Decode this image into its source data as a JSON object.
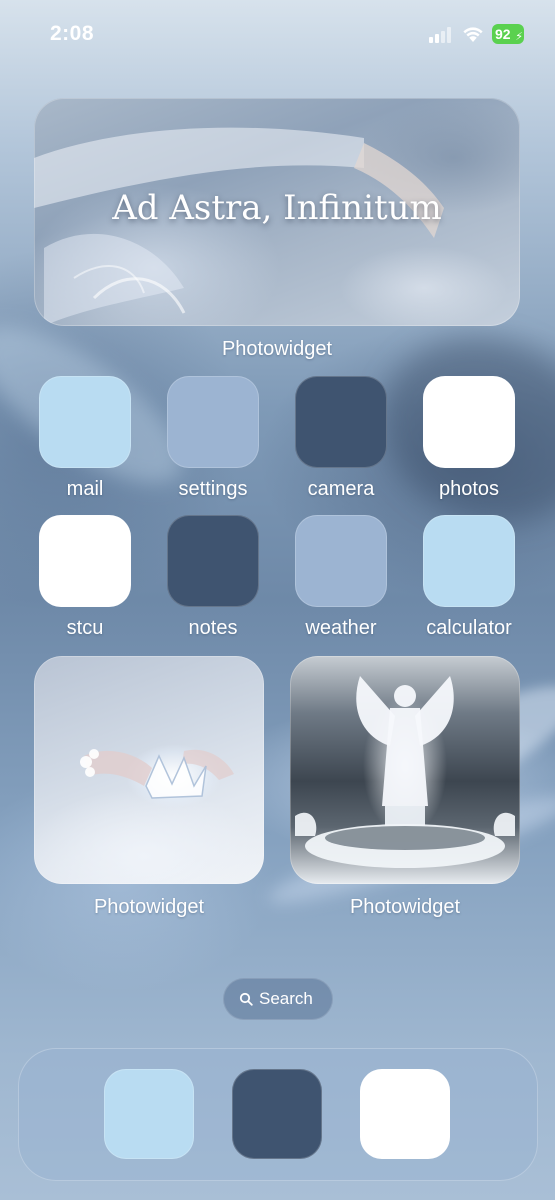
{
  "status_bar": {
    "time": "2:08",
    "battery": "92"
  },
  "top_widget": {
    "title": "Ad Astra, Infinitum",
    "label": "Photowidget"
  },
  "apps_row1": [
    {
      "label": "mail",
      "color": "#b9dcf2"
    },
    {
      "label": "settings",
      "color": "#9cb4d2"
    },
    {
      "label": "camera",
      "color": "#3f5470"
    },
    {
      "label": "photos",
      "color": "#ffffff"
    }
  ],
  "apps_row2": [
    {
      "label": "stcu",
      "color": "#ffffff"
    },
    {
      "label": "notes",
      "color": "#3f5470"
    },
    {
      "label": "weather",
      "color": "#9cb4d2"
    },
    {
      "label": "calculator",
      "color": "#b9dcf2"
    }
  ],
  "widget_left": {
    "label": "Photowidget"
  },
  "widget_right": {
    "label": "Photowidget"
  },
  "search": {
    "label": "Search"
  },
  "dock": [
    {
      "color": "#b9dcf2"
    },
    {
      "color": "#3f5470"
    },
    {
      "color": "#ffffff"
    }
  ]
}
